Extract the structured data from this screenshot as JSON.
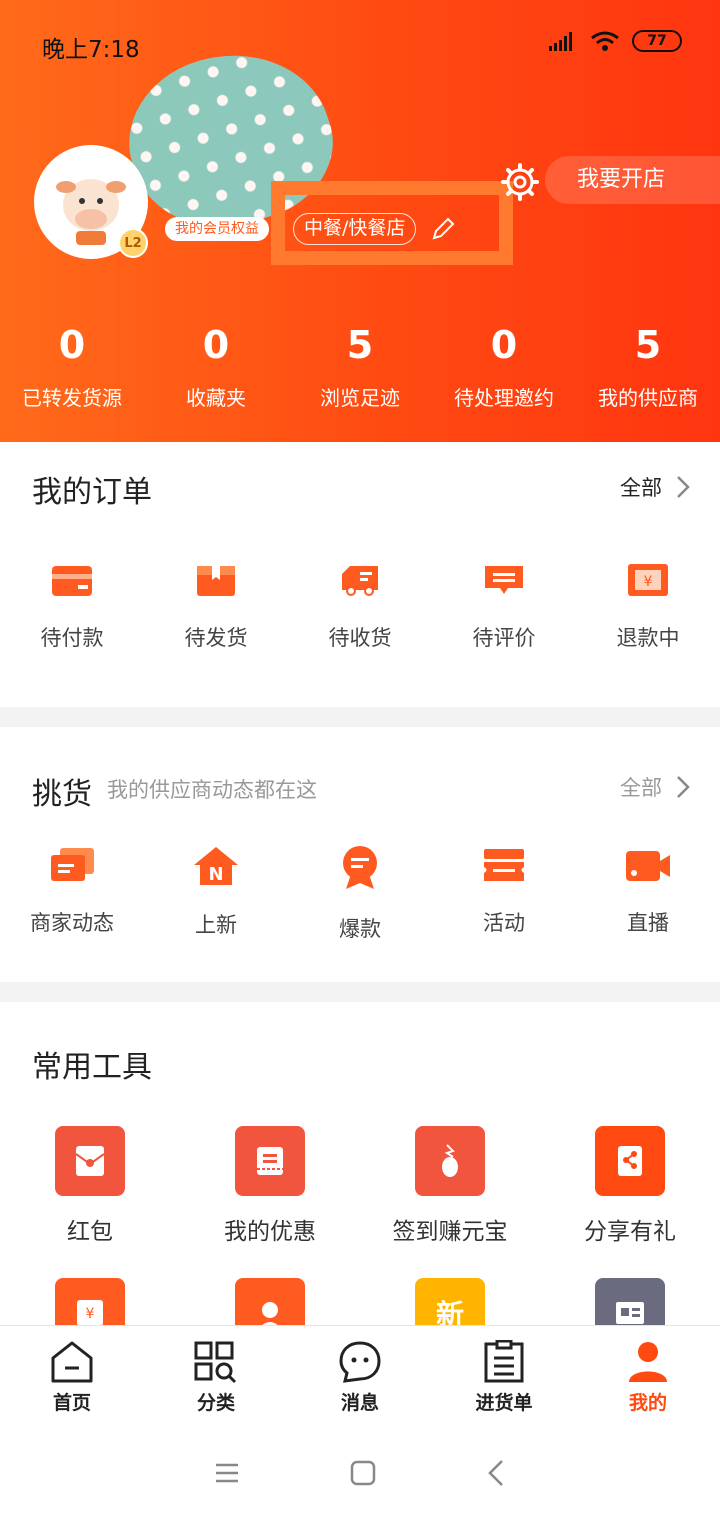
{
  "status_bar": {
    "time": "晚上7:18",
    "battery": "77"
  },
  "profile": {
    "level": "L2",
    "member_benefits": "我的会员权益",
    "shop_type": "中餐/快餐店",
    "open_shop_button": "我要开店"
  },
  "stats": [
    {
      "value": "0",
      "label": "已转发货源"
    },
    {
      "value": "0",
      "label": "收藏夹"
    },
    {
      "value": "5",
      "label": "浏览足迹"
    },
    {
      "value": "0",
      "label": "待处理邀约"
    },
    {
      "value": "5",
      "label": "我的供应商"
    }
  ],
  "orders": {
    "title": "我的订单",
    "more": "全部",
    "items": [
      {
        "label": "待付款",
        "icon": "wallet-icon"
      },
      {
        "label": "待发货",
        "icon": "package-icon"
      },
      {
        "label": "待收货",
        "icon": "truck-icon"
      },
      {
        "label": "待评价",
        "icon": "comment-icon"
      },
      {
        "label": "退款中",
        "icon": "refund-icon"
      }
    ]
  },
  "picking": {
    "title": "挑货",
    "subtitle": "我的供应商动态都在这",
    "more": "全部",
    "items": [
      {
        "label": "商家动态",
        "icon": "cards-icon"
      },
      {
        "label": "上新",
        "icon": "new-house-icon"
      },
      {
        "label": "爆款",
        "icon": "medal-icon"
      },
      {
        "label": "活动",
        "icon": "ticket-icon"
      },
      {
        "label": "直播",
        "icon": "video-camera-icon"
      }
    ]
  },
  "tools": {
    "title": "常用工具",
    "row1": [
      {
        "label": "红包",
        "icon": "red-envelope-icon"
      },
      {
        "label": "我的优惠",
        "icon": "coupon-icon"
      },
      {
        "label": "签到赚元宝",
        "icon": "checkin-icon"
      },
      {
        "label": "分享有礼",
        "icon": "share-icon"
      }
    ],
    "row2": [
      {
        "icon": "yuan-envelope-icon"
      },
      {
        "icon": "customer-service-icon"
      },
      {
        "label": "新",
        "icon": "new-badge-icon"
      },
      {
        "icon": "news-icon"
      }
    ]
  },
  "colors": {
    "accent": "#ff4a12",
    "header_start": "#ff6a1a",
    "header_end": "#ff3510"
  },
  "bottom_nav": [
    {
      "label": "首页",
      "icon": "home-icon"
    },
    {
      "label": "分类",
      "icon": "category-icon"
    },
    {
      "label": "消息",
      "icon": "message-icon"
    },
    {
      "label": "进货单",
      "icon": "list-icon"
    },
    {
      "label": "我的",
      "icon": "user-icon",
      "active": true
    }
  ]
}
